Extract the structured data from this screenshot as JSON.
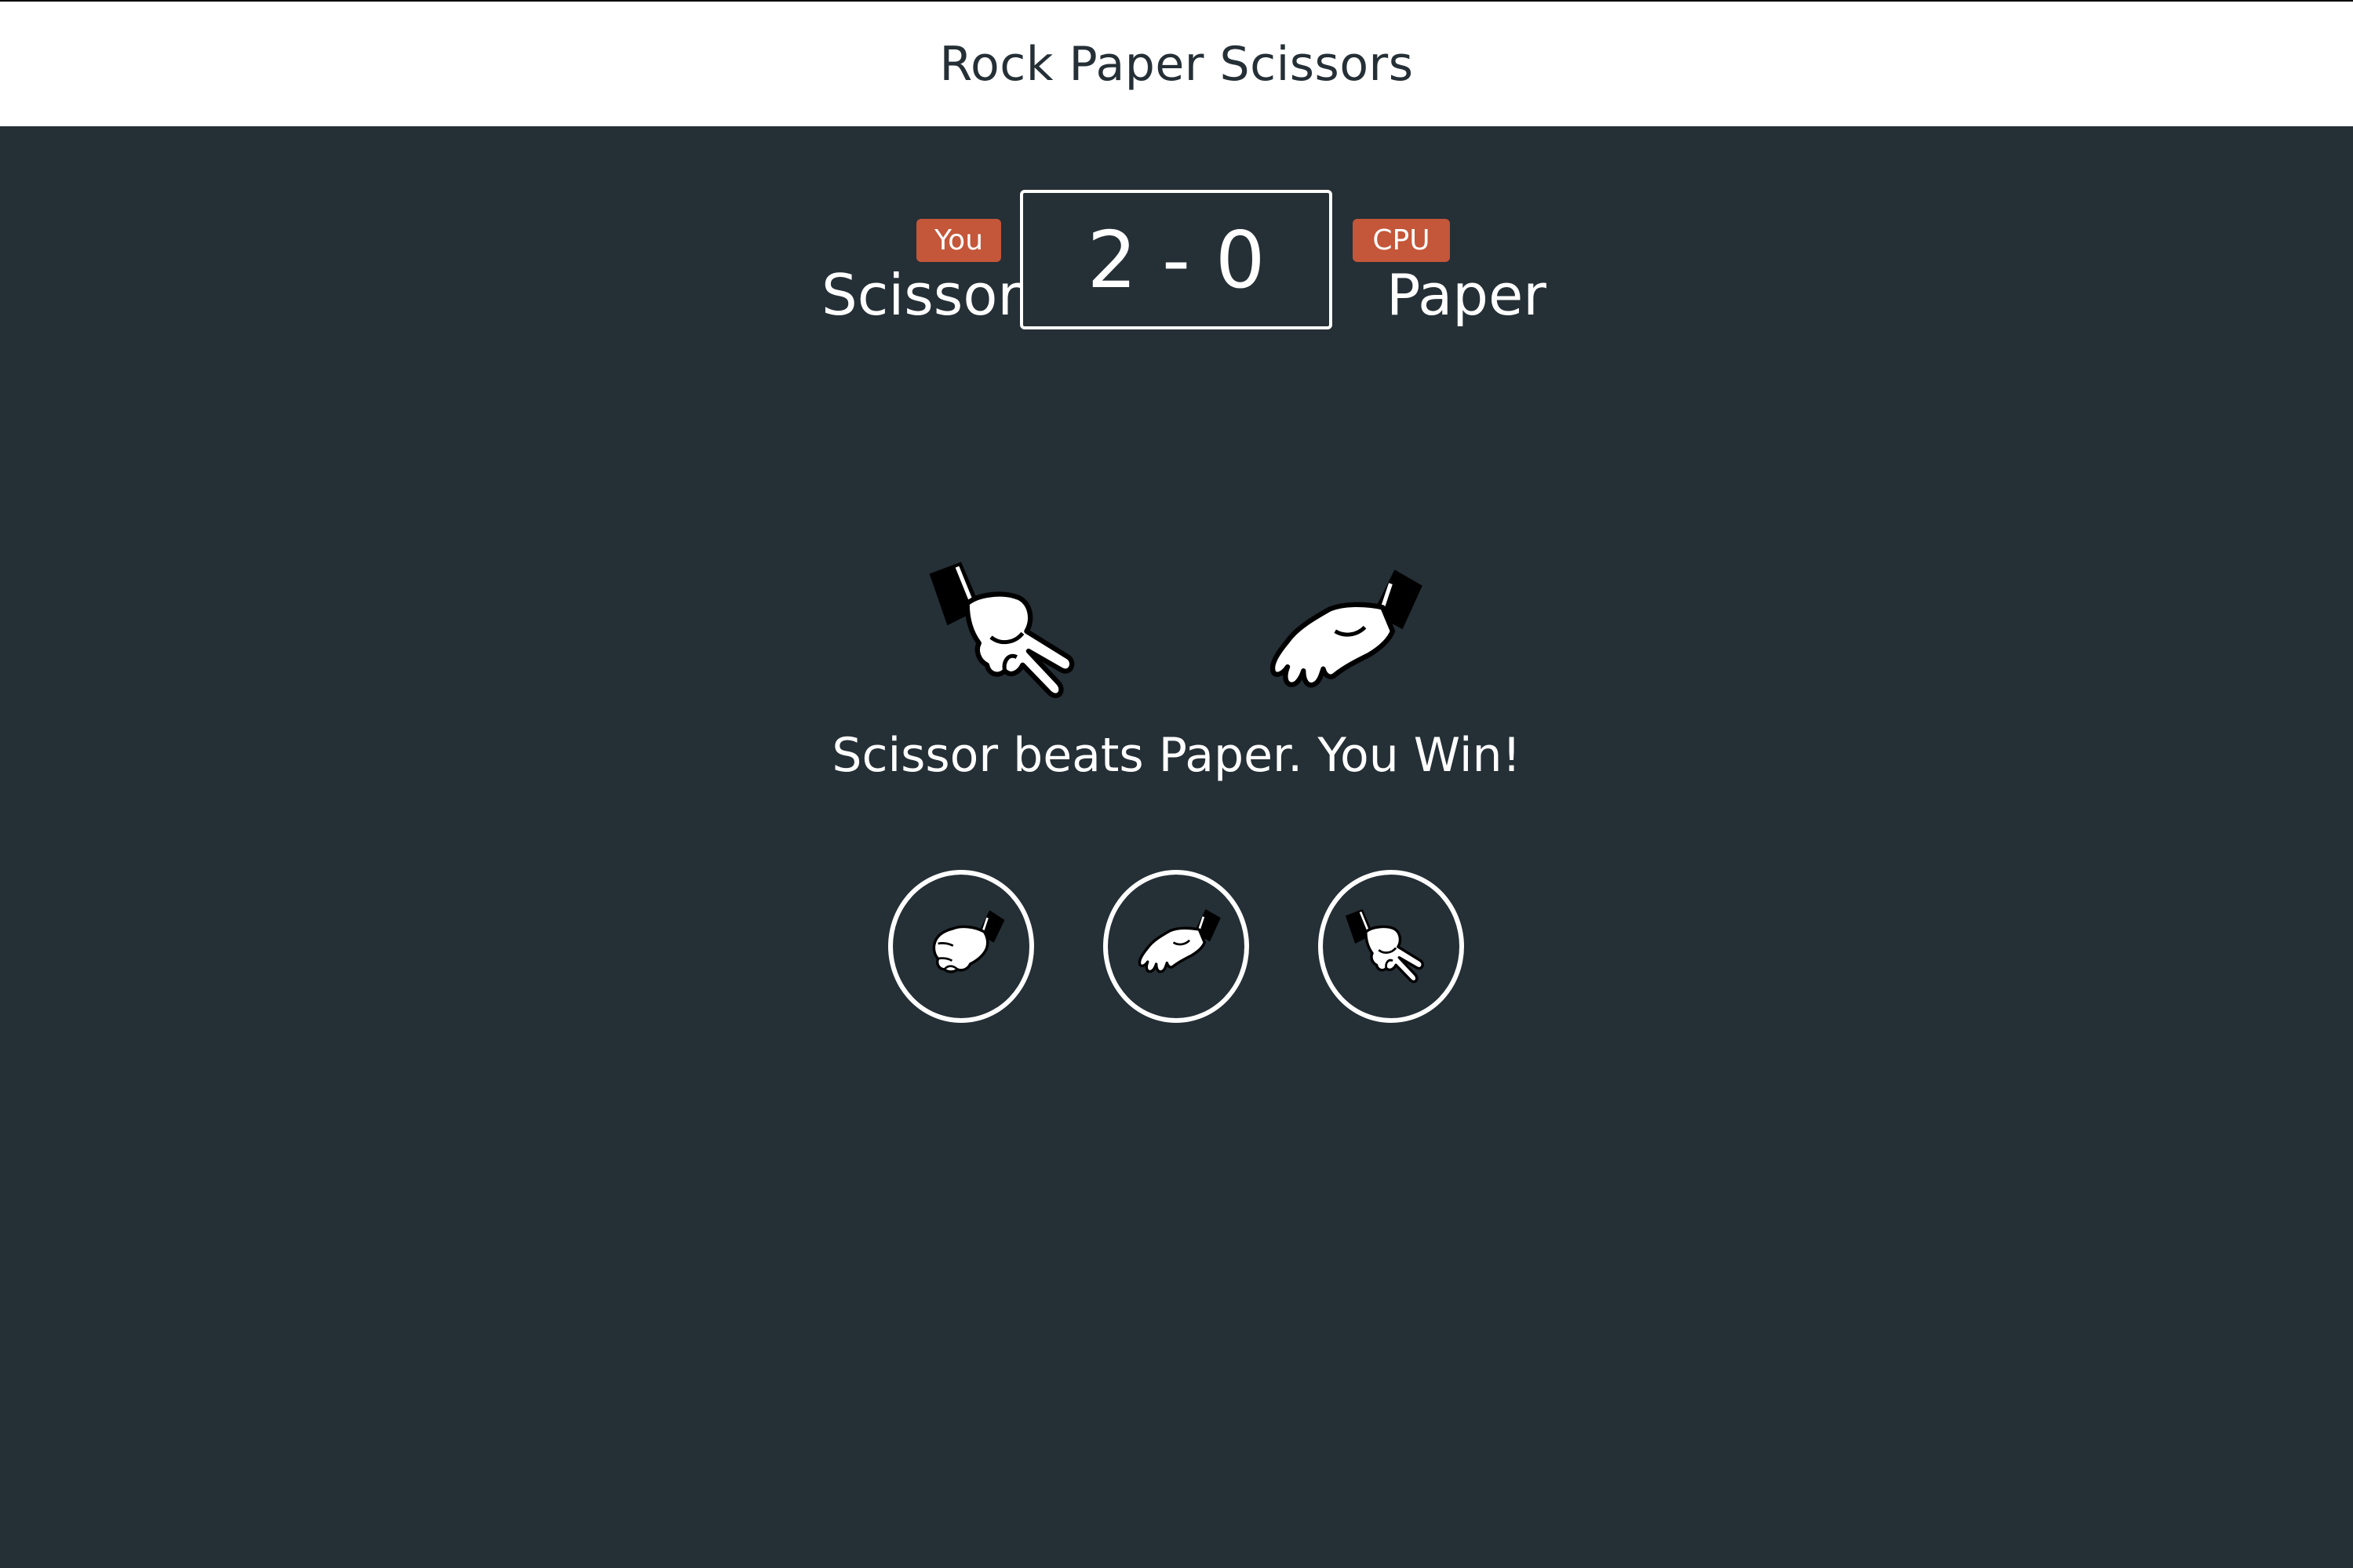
{
  "header": {
    "title": "Rock Paper Scissors"
  },
  "player": {
    "badge": "You",
    "choice": "Scissor"
  },
  "cpu": {
    "badge": "CPU",
    "choice": "Paper"
  },
  "score": {
    "text": "2 - 0",
    "player": 2,
    "cpu": 0
  },
  "result": {
    "message": "Scissor beats Paper. You Win!"
  },
  "choices": [
    {
      "name": "rock",
      "icon": "rock-hand-icon"
    },
    {
      "name": "paper",
      "icon": "paper-hand-icon"
    },
    {
      "name": "scissors",
      "icon": "scissors-hand-icon"
    }
  ],
  "colors": {
    "background": "#252f36",
    "header_background": "#ffffff",
    "badge": "#c4563a",
    "text": "#ffffff"
  }
}
